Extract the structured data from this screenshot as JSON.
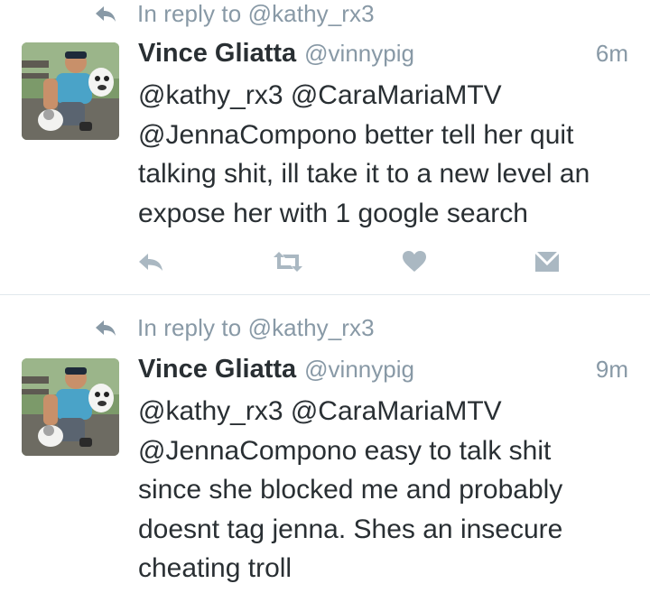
{
  "tweets": [
    {
      "reply_context": "In reply to @kathy_rx3",
      "author_name": "Vince Gliatta",
      "author_handle": "@vinnypig",
      "time": "6m",
      "text_lines": [
        "@kathy_rx3 @CaraMariaMTV",
        "@JennaCompono better tell her quit",
        "talking shit, ill take it to a new level an",
        "expose her with 1 google search"
      ],
      "actions": [
        "reply-icon",
        "retweet-icon",
        "like-heart-icon",
        "direct-message-icon"
      ]
    },
    {
      "reply_context": "In reply to @kathy_rx3",
      "author_name": "Vince Gliatta",
      "author_handle": "@vinnypig",
      "time": "9m",
      "text_lines": [
        "@kathy_rx3 @CaraMariaMTV",
        "@JennaCompono easy to talk shit",
        "since she blocked me and probably",
        "doesnt tag jenna. Shes an insecure",
        "cheating troll"
      ]
    }
  ],
  "colors": {
    "text": "#292f33",
    "secondary": "#8899a6",
    "action_icon": "#aab8c2",
    "divider": "#e1e8ed"
  }
}
